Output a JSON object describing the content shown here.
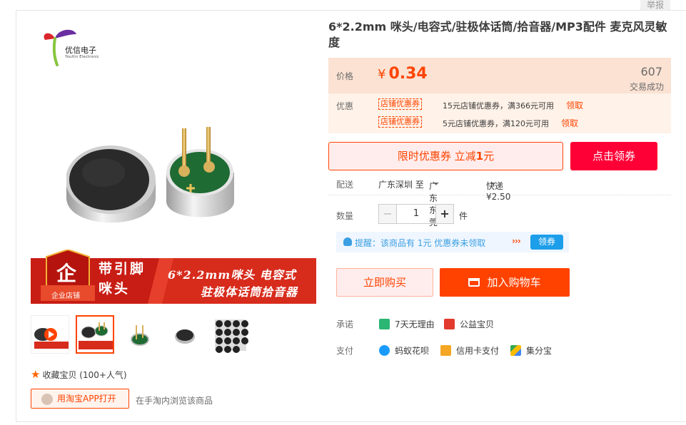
{
  "report": "举报",
  "brand": {
    "name": "优信电子",
    "sub": "YouXin Electronic"
  },
  "banner": {
    "badge_char": "企",
    "badge_text": "企业店铺",
    "left_line1": "带引脚",
    "left_line2": "咪头",
    "right_line1": "6*2.2mm咪头 电容式",
    "right_line2": "驻极体话筒拾音器"
  },
  "title": "6*2.2mm 咪头/电容式/驻极体话筒/拾音器/MP3配件 麦克风灵敏度",
  "price": {
    "label": "价格",
    "currency": "¥",
    "value": "0.34",
    "sold_count": "607",
    "sold_label": "交易成功"
  },
  "promo": {
    "label": "优惠",
    "coupons": [
      {
        "tag": "店铺优惠券",
        "text": "15元店铺优惠券，满366元可用",
        "action": "领取"
      },
      {
        "tag": "店铺优惠券",
        "text": "5元店铺优惠券，满120元可用",
        "action": "领取"
      }
    ]
  },
  "limited": {
    "prefix": "限时优惠券 立减",
    "amount": "1",
    "suffix": "元",
    "button": "点击领券"
  },
  "shipping": {
    "label": "配送",
    "from": "广东深圳 至",
    "to": "广东东莞",
    "method": "快递 ¥2.50"
  },
  "quantity": {
    "label": "数量",
    "minus": "−",
    "value": "1",
    "plus": "+",
    "unit": "件"
  },
  "notice": {
    "text": "提醒：该商品有 1元 优惠券未领取",
    "arrows": "›››",
    "button": "领券"
  },
  "actions": {
    "buy_now": "立即购买",
    "add_cart": "加入购物车"
  },
  "promise": {
    "label": "承诺",
    "items": [
      "7天无理由",
      "公益宝贝"
    ]
  },
  "payment": {
    "label": "支付",
    "items": [
      "蚂蚁花呗",
      "信用卡支付",
      "集分宝"
    ]
  },
  "favorite": {
    "text": "收藏宝贝 (100+人气)"
  },
  "app": {
    "button": "用淘宝APP打开",
    "note": "在手淘内浏览该商品"
  },
  "colors": {
    "accent": "#ff4400",
    "coupon_red": "#ff0036",
    "info_blue": "#3b9fe3"
  }
}
